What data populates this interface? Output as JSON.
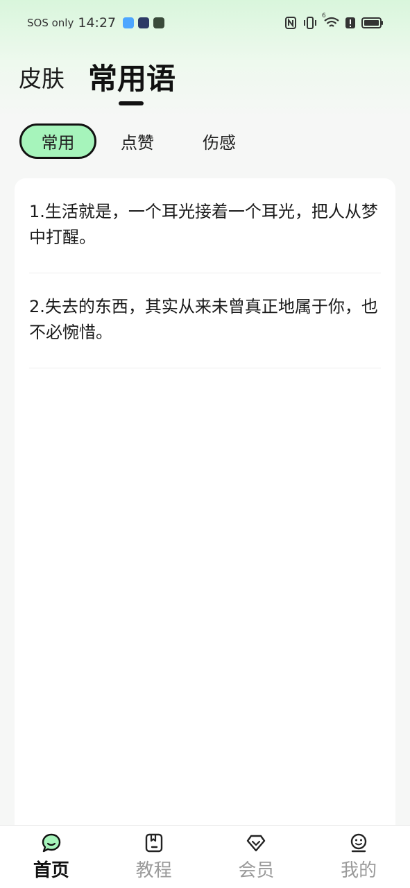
{
  "status_bar": {
    "carrier_text": "SOS only",
    "time": "14:27",
    "network_superscript": "6"
  },
  "header": {
    "tabs": [
      {
        "label": "皮肤",
        "active": false
      },
      {
        "label": "常用语",
        "active": true
      }
    ]
  },
  "categories": [
    {
      "label": "常用",
      "active": true
    },
    {
      "label": "点赞",
      "active": false
    },
    {
      "label": "伤感",
      "active": false
    }
  ],
  "phrases": [
    {
      "text": "1.生活就是，一个耳光接着一个耳光，把人从梦中打醒。"
    },
    {
      "text": "2.失去的东西，其实从来未曾真正地属于你，也不必惋惜。"
    }
  ],
  "bottom_nav": [
    {
      "label": "首页",
      "icon": "chat-bubble-icon",
      "active": true
    },
    {
      "label": "教程",
      "icon": "bookmark-book-icon",
      "active": false
    },
    {
      "label": "会员",
      "icon": "diamond-icon",
      "active": false
    },
    {
      "label": "我的",
      "icon": "smiley-profile-icon",
      "active": false
    }
  ],
  "colors": {
    "accent": "#a6f4bb",
    "nav_active_icon": "#a6f4bb",
    "text_primary": "#111111",
    "text_inactive": "#9a9a9a"
  }
}
